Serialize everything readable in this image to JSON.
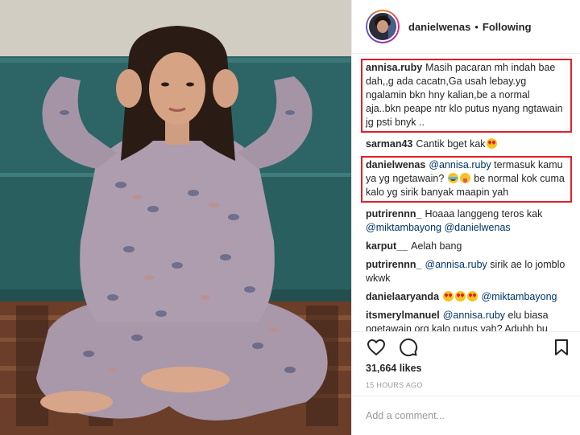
{
  "header": {
    "username": "danielwenas",
    "separator": "•",
    "follow_status": "Following"
  },
  "comments": [
    {
      "user": "annisa.ruby",
      "text": "Masih pacaran mh indah bae dah,,g ada cacatn,Ga usah lebay.yg ngalamin bkn hny kalian,be a normal aja..bkn peape ntr klo putus nyang ngtawain jg psti bnyk ..",
      "highlighted": true
    },
    {
      "user": "sarman43",
      "text": "Cantik bget kak",
      "emoji": [
        "heart-eyes"
      ]
    },
    {
      "user": "danielwenas",
      "mention": "@annisa.ruby",
      "text_before_emoji": "termasuk kamu ya yg ngetawain?",
      "text_after_emoji": "be normal kok cuma kalo yg sirik banyak maapin yah",
      "emoji": [
        "tears-of-joy",
        "tongue"
      ],
      "highlighted": true
    },
    {
      "user": "putrirennn_",
      "text": "Hoaaa langgeng teros kak",
      "mentions": [
        "@miktambayong",
        "@danielwenas"
      ]
    },
    {
      "user": "karput__",
      "text": "Aelah bang"
    },
    {
      "user": "putrirennn_",
      "mention": "@annisa.ruby",
      "text": "sirik ae lo jomblo wkwk"
    },
    {
      "user": "danielaaryanda",
      "emoji": [
        "heart-eyes",
        "heart-eyes",
        "heart-eyes"
      ],
      "mention": "@miktambayong"
    },
    {
      "user": "itsmerylmanuel",
      "mention": "@annisa.ruby",
      "text": "elu biasa ngetawain org kalo putus yah? Aduhh bu semoga hdpnya SELALU bahagia deh yah"
    }
  ],
  "actions": {
    "like_icon": "heart-outline-icon",
    "comment_icon": "comment-bubble-icon",
    "save_icon": "bookmark-icon",
    "likes": "31,664 likes",
    "timestamp": "15 HOURS AGO"
  },
  "add_comment": {
    "placeholder": "Add a comment..."
  },
  "colors": {
    "highlight_border": "#e0202a",
    "mention": "#003569",
    "muted": "#999999",
    "text": "#262626",
    "sofa": "#2f6b6b",
    "pajama": "#a89aa8"
  }
}
